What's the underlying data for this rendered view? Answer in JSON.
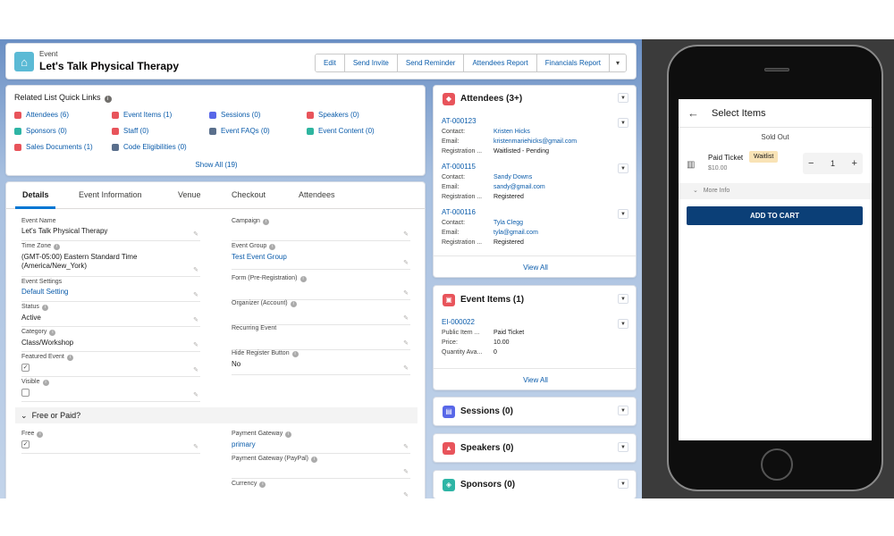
{
  "header": {
    "object_label": "Event",
    "title": "Let's Talk Physical Therapy",
    "buttons": [
      "Edit",
      "Send Invite",
      "Send Reminder",
      "Attendees Report",
      "Financials Report",
      "▾"
    ]
  },
  "related_links": {
    "title": "Related List Quick Links",
    "links": [
      {
        "label": "Attendees (6)",
        "color": "#e8545b"
      },
      {
        "label": "Event Items (1)",
        "color": "#e8545b"
      },
      {
        "label": "Sessions (0)",
        "color": "#5867e8"
      },
      {
        "label": "Speakers (0)",
        "color": "#e8545b"
      },
      {
        "label": "Sponsors (0)",
        "color": "#2eb5a5"
      },
      {
        "label": "Staff (0)",
        "color": "#e8545b"
      },
      {
        "label": "Event FAQs (0)",
        "color": "#5a6f8c"
      },
      {
        "label": "Event Content (0)",
        "color": "#2eb59f"
      },
      {
        "label": "Sales Documents (1)",
        "color": "#e8545b"
      },
      {
        "label": "Code Eligibilities (0)",
        "color": "#5a6f8c"
      }
    ],
    "show_all": "Show All (19)"
  },
  "tabs": [
    "Details",
    "Event Information",
    "Venue",
    "Checkout",
    "Attendees"
  ],
  "fields": {
    "event_name": {
      "label": "Event Name",
      "value": "Let's Talk Physical Therapy"
    },
    "time_zone": {
      "label": "Time Zone",
      "value": "(GMT-05:00) Eastern Standard Time (America/New_York)"
    },
    "event_settings": {
      "label": "Event Settings",
      "value": "Default Setting"
    },
    "status": {
      "label": "Status",
      "value": "Active"
    },
    "category": {
      "label": "Category",
      "value": "Class/Workshop"
    },
    "featured_event": {
      "label": "Featured Event",
      "value": "✓"
    },
    "visible": {
      "label": "Visible",
      "value": ""
    },
    "campaign": {
      "label": "Campaign",
      "value": ""
    },
    "event_group": {
      "label": "Event Group",
      "value": "Test Event Group"
    },
    "form": {
      "label": "Form (Pre-Registration)",
      "value": ""
    },
    "organizer": {
      "label": "Organizer (Account)",
      "value": ""
    },
    "recurring": {
      "label": "Recurring Event",
      "value": ""
    },
    "hide_register": {
      "label": "Hide Register Button",
      "value": "No"
    },
    "section_title": "Free or Paid?",
    "free": {
      "label": "Free",
      "value": "✓"
    },
    "payment_gateway": {
      "label": "Payment Gateway",
      "value": "primary"
    },
    "payment_gateway_paypal": {
      "label": "Payment Gateway (PayPal)",
      "value": ""
    },
    "currency": {
      "label": "Currency",
      "value": ""
    }
  },
  "attendees": {
    "title": "Attendees (3+)",
    "records": [
      {
        "id": "AT-000123",
        "contact": "Kristen Hicks",
        "email": "kristenmariehicks@gmail.com",
        "status": "Waitlisted - Pending"
      },
      {
        "id": "AT-000115",
        "contact": "Sandy Downs",
        "email": "sandy@gmail.com",
        "status": "Registered"
      },
      {
        "id": "AT-000116",
        "contact": "Tyla Clegg",
        "email": "tyla@gmail.com",
        "status": "Registered"
      }
    ],
    "keys": {
      "contact": "Contact:",
      "email": "Email:",
      "registration": "Registration ..."
    },
    "view_all": "View All"
  },
  "event_items": {
    "title": "Event Items (1)",
    "record": {
      "id": "EI-000022",
      "k1": "Public Item ...",
      "v1": "Paid Ticket",
      "k2": "Price:",
      "v2": "10.00",
      "k3": "Quantity Ava...",
      "v3": "0"
    },
    "view_all": "View All"
  },
  "sessions": {
    "title": "Sessions (0)"
  },
  "speakers": {
    "title": "Speakers (0)"
  },
  "sponsors": {
    "title": "Sponsors (0)"
  },
  "phone": {
    "title": "Select Items",
    "sold_out": "Sold Out",
    "item_name": "Paid Ticket",
    "item_price": "$10.00",
    "badge": "Waitlist",
    "quantity": "1",
    "more_info": "More Info",
    "add_to_cart": "ADD TO CART"
  }
}
